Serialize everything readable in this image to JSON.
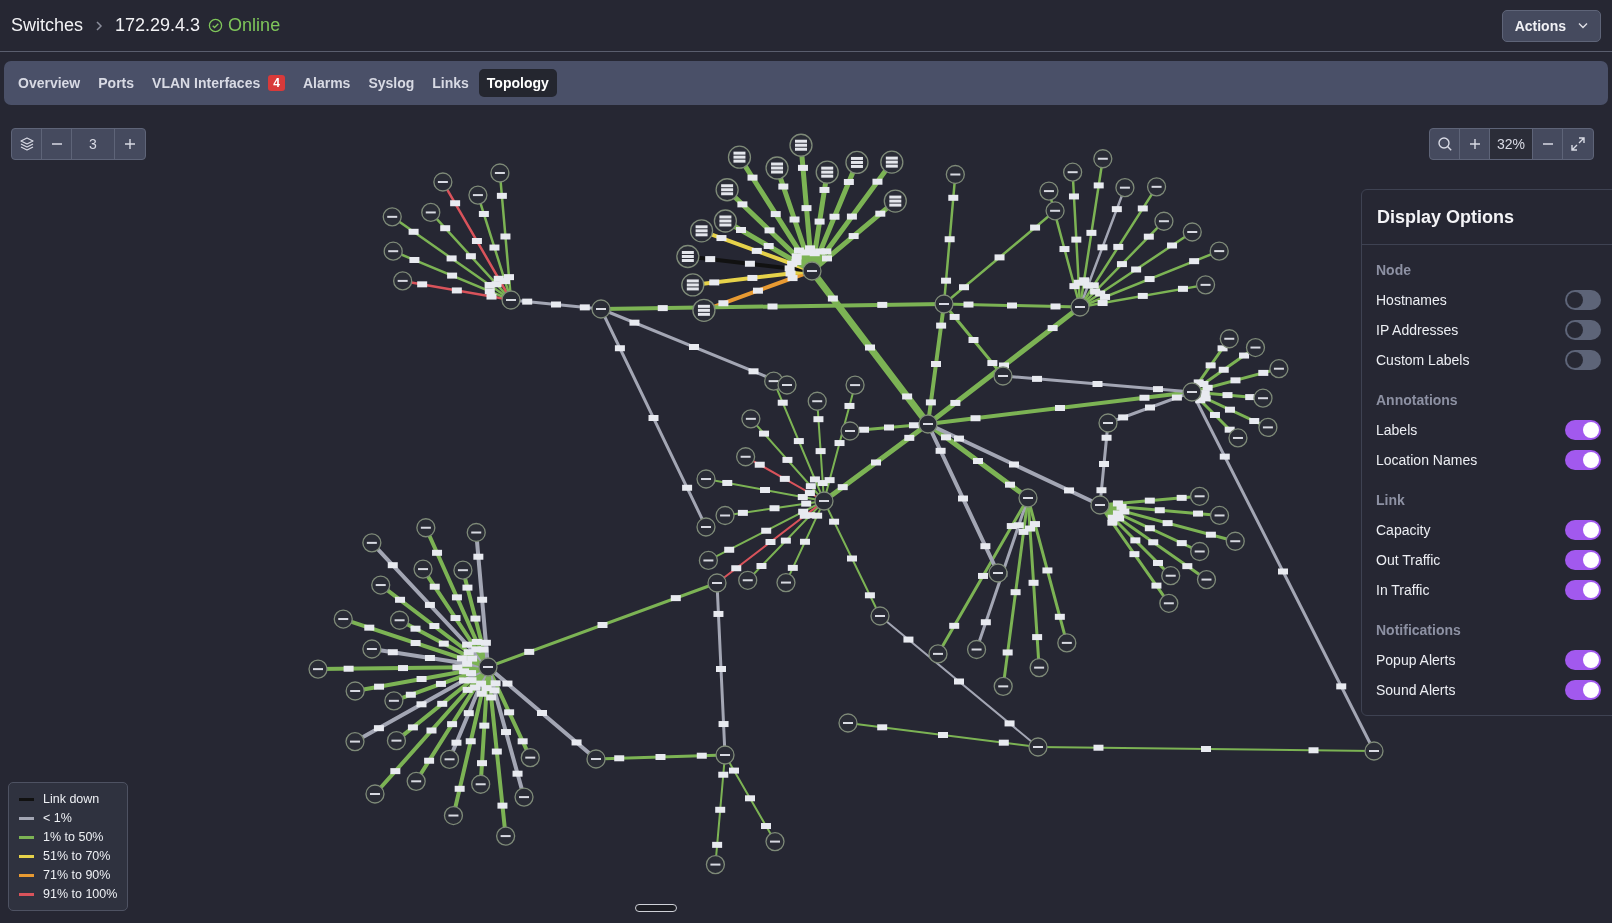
{
  "breadcrumb": {
    "parent": "Switches",
    "current": "172.29.4.3",
    "status": "Online"
  },
  "actions_button": {
    "label": "Actions"
  },
  "tabs": [
    {
      "label": "Overview",
      "selected": false
    },
    {
      "label": "Ports",
      "selected": false
    },
    {
      "label": "VLAN Interfaces",
      "badge": "4",
      "selected": false
    },
    {
      "label": "Alarms",
      "selected": false
    },
    {
      "label": "Syslog",
      "selected": false
    },
    {
      "label": "Links",
      "selected": false
    },
    {
      "label": "Topology",
      "selected": true
    }
  ],
  "depth_control": {
    "value": "3"
  },
  "zoom_control": {
    "value": "32%"
  },
  "display_options": {
    "title": "Display Options",
    "sections": [
      {
        "heading": "Node",
        "options": [
          {
            "label": "Hostnames",
            "on": false
          },
          {
            "label": "IP Addresses",
            "on": false
          },
          {
            "label": "Custom Labels",
            "on": false
          }
        ]
      },
      {
        "heading": "Annotations",
        "options": [
          {
            "label": "Labels",
            "on": true
          },
          {
            "label": "Location Names",
            "on": true
          }
        ]
      },
      {
        "heading": "Link",
        "options": [
          {
            "label": "Capacity",
            "on": true
          },
          {
            "label": "Out Traffic",
            "on": true
          },
          {
            "label": "In Traffic",
            "on": true
          }
        ]
      },
      {
        "heading": "Notifications",
        "options": [
          {
            "label": "Popup Alerts",
            "on": true
          },
          {
            "label": "Sound Alerts",
            "on": true
          }
        ]
      }
    ]
  },
  "legend": [
    {
      "label": "Link down",
      "color": "#111111"
    },
    {
      "label": "< 1%",
      "color": "#a3a6b4"
    },
    {
      "label": "1% to 50%",
      "color": "#7cb354"
    },
    {
      "label": "51% to 70%",
      "color": "#e6d24a"
    },
    {
      "label": "71% to 90%",
      "color": "#e89a32"
    },
    {
      "label": "91% to 100%",
      "color": "#d9535b"
    }
  ]
}
